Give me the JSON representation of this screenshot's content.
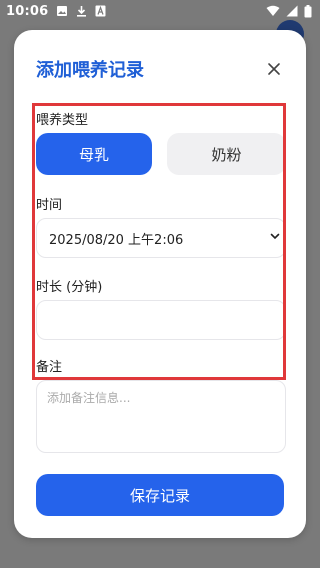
{
  "status_bar": {
    "time": "10:06",
    "icons": [
      "image-icon",
      "download-icon",
      "font-icon",
      "wifi-icon",
      "signal-icon",
      "battery-icon"
    ]
  },
  "dialog": {
    "title": "添加喂养记录",
    "close_icon": "close-icon",
    "feeding_type": {
      "label": "喂养类型",
      "options": [
        "母乳",
        "奶粉"
      ],
      "selected": "母乳"
    },
    "time": {
      "label": "时间",
      "value": "2025/08/20 上午2:06",
      "icon": "chevron-down-icon"
    },
    "duration": {
      "label": "时长 (分钟)",
      "value": ""
    },
    "notes": {
      "label": "备注",
      "placeholder": "添加备注信息..."
    },
    "save_label": "保存记录"
  },
  "colors": {
    "accent": "#2563eb",
    "title": "#1f5fd6",
    "highlight": "#e0383a",
    "scrim": "#7a7a7a"
  }
}
